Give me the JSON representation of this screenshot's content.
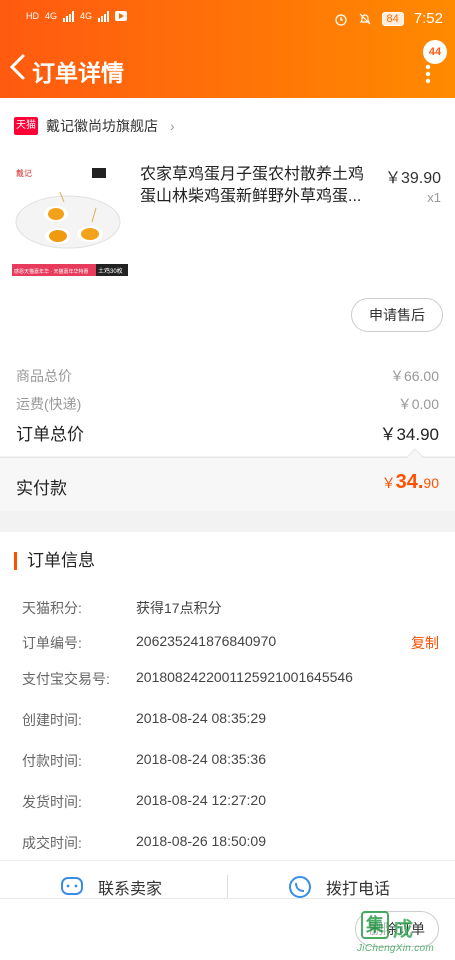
{
  "status": {
    "network": "HD",
    "sig1": "4G",
    "sig2": "4G",
    "battery": "84",
    "time": "7:52"
  },
  "header": {
    "title": "订单详情",
    "badge": "44"
  },
  "shop": {
    "badge": "天猫",
    "name": "戴记徽尚坊旗舰店"
  },
  "product": {
    "name": "农家草鸡蛋月子蛋农村散养土鸡蛋山林柴鸡蛋新鲜野外草鸡蛋...",
    "price": "￥39.90",
    "qty": "x1",
    "after_sale": "申请售后",
    "img_brand": "戴记",
    "img_strip_left": "感恩天猫嘉年华 · 天猫嘉年华特惠",
    "img_strip_right": "土鸡30枚"
  },
  "summary": {
    "goods_label": "商品总价",
    "goods_value": "￥66.00",
    "ship_label": "运费(快递)",
    "ship_value": "￥0.00",
    "total_label": "订单总价",
    "total_value": "￥34.90"
  },
  "paid": {
    "label": "实付款",
    "currency": "￥",
    "amount": "34.",
    "cents": "90"
  },
  "info": {
    "title": "订单信息",
    "rows": [
      {
        "k": "天猫积分:",
        "v": "获得17点积分"
      },
      {
        "k": "订单编号:",
        "v": "206235241876840970",
        "action": "复制"
      },
      {
        "k": "支付宝交易号:",
        "v": "2018082422001125921001645546"
      },
      {
        "k": "创建时间:",
        "v": "2018-08-24 08:35:29"
      },
      {
        "k": "付款时间:",
        "v": "2018-08-24 08:35:36"
      },
      {
        "k": "发货时间:",
        "v": "2018-08-24 12:27:20"
      },
      {
        "k": "成交时间:",
        "v": "2018-08-26 18:50:09"
      }
    ]
  },
  "actions": {
    "contact": "联系卖家",
    "call": "拨打电话"
  },
  "bottom": {
    "delete": "删除订单"
  },
  "watermark": {
    "mark": "集",
    "text": "成",
    "url": "JiChengXin.com"
  },
  "colors": {
    "accent": "#ff5000",
    "header_start": "#ff5a10",
    "header_end": "#ff8a00"
  }
}
